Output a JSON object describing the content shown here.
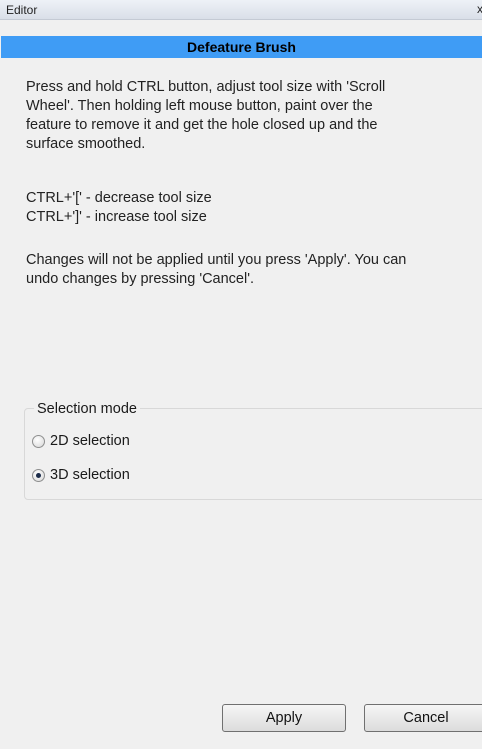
{
  "window": {
    "title": "Editor",
    "close_glyph": "x"
  },
  "panel": {
    "title": "Defeature Brush"
  },
  "instructions": {
    "paragraph1": "Press and hold CTRL button, adjust tool size with 'Scroll\nWheel'. Then holding left mouse button, paint over the\nfeature to remove it and get the hole closed up and the\nsurface smoothed.",
    "paragraph2": "CTRL+'[' - decrease tool size\nCTRL+']' - increase tool size",
    "paragraph3": "Changes will not be applied until you press 'Apply'. You can\nundo changes by pressing 'Cancel'."
  },
  "selection_mode": {
    "label": "Selection mode",
    "options": [
      {
        "label": "2D selection",
        "checked": false
      },
      {
        "label": "3D selection",
        "checked": true
      }
    ]
  },
  "buttons": {
    "apply": "Apply",
    "cancel": "Cancel"
  }
}
